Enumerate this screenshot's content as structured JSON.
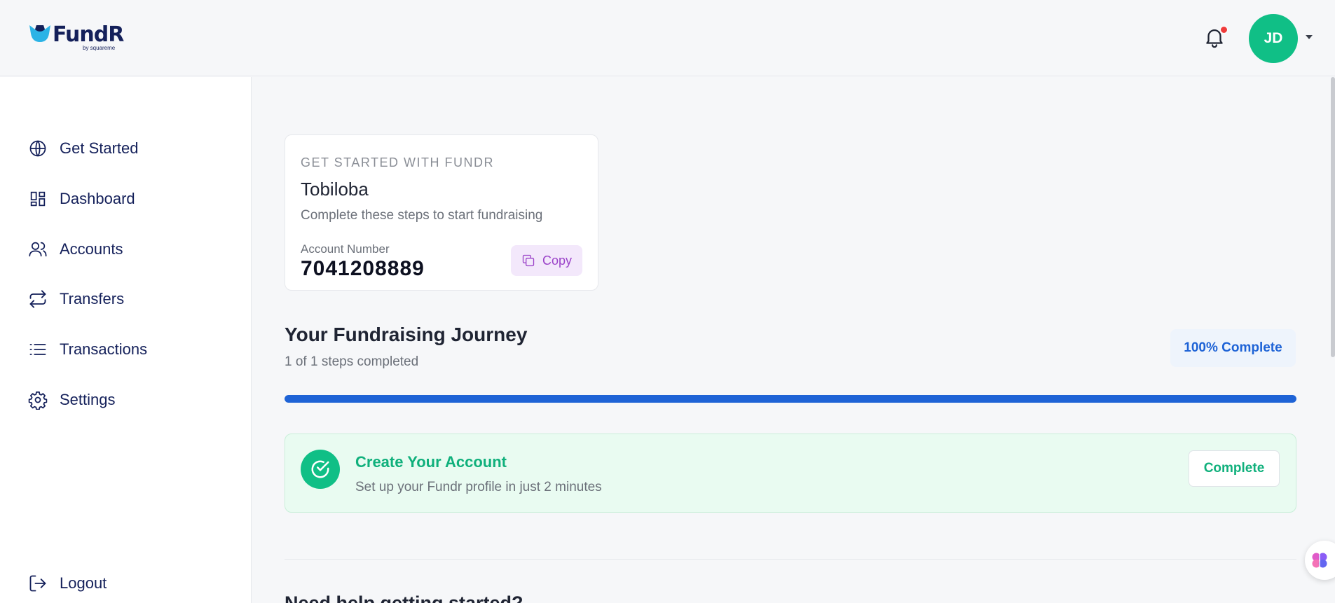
{
  "brand": {
    "name": "FundR",
    "tagline": "by squareme",
    "colors": {
      "navy": "#14205a",
      "green": "#10bf86",
      "blue": "#1e63d6",
      "purple": "#9b43c9"
    }
  },
  "header": {
    "bell_icon": "bell-icon",
    "has_notification": true,
    "avatar_initials": "JD",
    "menu_icon": "chevron-down-icon"
  },
  "sidebar": {
    "items": [
      {
        "label": "Get Started",
        "icon": "globe-icon"
      },
      {
        "label": "Dashboard",
        "icon": "dashboard-icon"
      },
      {
        "label": "Accounts",
        "icon": "users-icon"
      },
      {
        "label": "Transfers",
        "icon": "transfer-icon"
      },
      {
        "label": "Transactions",
        "icon": "list-icon"
      },
      {
        "label": "Settings",
        "icon": "gear-icon"
      }
    ],
    "logout": {
      "label": "Logout",
      "icon": "logout-icon"
    }
  },
  "account_card": {
    "eyebrow": "GET STARTED WITH FUNDR",
    "name": "Tobiloba",
    "description": "Complete these steps to start fundraising",
    "account_label": "Account Number",
    "account_number": "7041208889",
    "copy_label": "Copy"
  },
  "journey": {
    "title": "Your Fundraising Journey",
    "subtitle": "1 of 1 steps completed",
    "badge": "100% Complete",
    "progress": 1.0
  },
  "step": {
    "title": "Create Your Account",
    "description": "Set up your Fundr profile in just 2 minutes",
    "button_label": "Complete"
  },
  "help": {
    "title": "Need help getting started?"
  }
}
